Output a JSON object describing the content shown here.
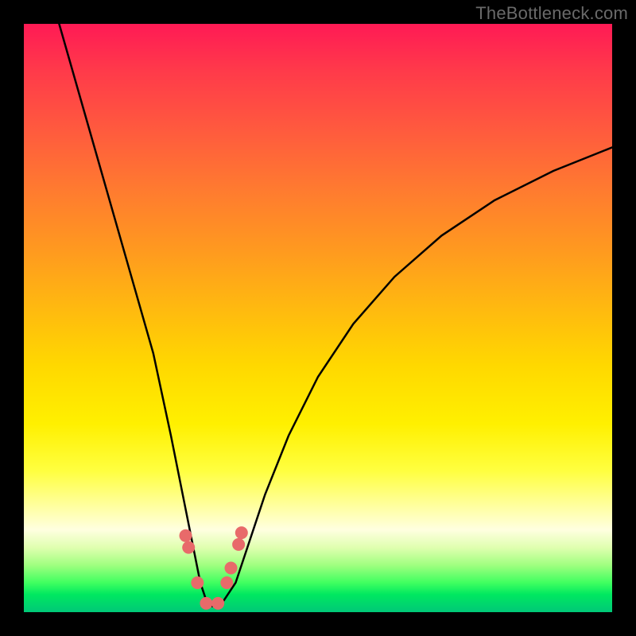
{
  "watermark": {
    "text": "TheBottleneck.com"
  },
  "chart_data": {
    "type": "line",
    "title": "",
    "xlabel": "",
    "ylabel": "",
    "xlim": [
      0,
      100
    ],
    "ylim": [
      0,
      100
    ],
    "series": [
      {
        "name": "bottleneck-curve",
        "x": [
          6,
          10,
          14,
          18,
          22,
          25,
          27,
          29,
          30,
          31,
          32,
          33,
          34,
          36,
          38,
          41,
          45,
          50,
          56,
          63,
          71,
          80,
          90,
          100
        ],
        "values": [
          100,
          86,
          72,
          58,
          44,
          30,
          20,
          10,
          5,
          2,
          1,
          1,
          2,
          5,
          11,
          20,
          30,
          40,
          49,
          57,
          64,
          70,
          75,
          79
        ]
      }
    ],
    "markers": {
      "name": "highlighted-points",
      "color": "#e86a6a",
      "x": [
        27.5,
        28.0,
        29.5,
        31.0,
        33.0,
        34.5,
        35.2,
        36.5,
        37.0
      ],
      "values": [
        13.0,
        11.0,
        5.0,
        1.5,
        1.5,
        5.0,
        7.5,
        11.5,
        13.5
      ]
    },
    "grid": false,
    "legend": false,
    "background_gradient": {
      "stops": [
        {
          "pos": 0,
          "color": "#ff1a55"
        },
        {
          "pos": 50,
          "color": "#ffc400"
        },
        {
          "pos": 82,
          "color": "#ffffa0"
        },
        {
          "pos": 100,
          "color": "#00c878"
        }
      ]
    }
  }
}
